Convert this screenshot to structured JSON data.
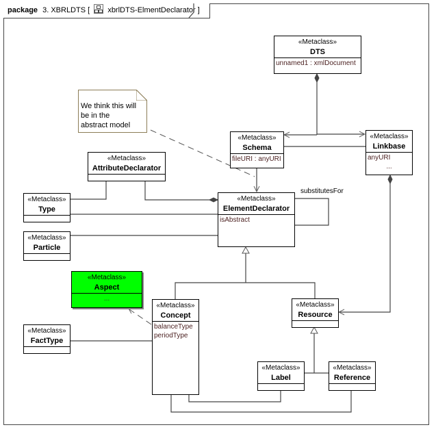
{
  "package": {
    "keyword": "package",
    "name": "3. XBRLDTS",
    "diagram_icon": "class-diagram-icon",
    "diagram_name": "xbrlDTS-ElmentDeclarator",
    "bracket_open": "[",
    "bracket_close": "]"
  },
  "note": {
    "text_lines": [
      "We think this will",
      "be in the",
      "abstract model"
    ]
  },
  "classes": {
    "dts": {
      "stereotype": "«Metaclass»",
      "name": "DTS",
      "attributes": [
        "unnamed1 : xmlDocument"
      ]
    },
    "schema": {
      "stereotype": "«Metaclass»",
      "name": "Schema",
      "attributes": [
        "fileURI : anyURI"
      ]
    },
    "linkbase": {
      "stereotype": "«Metaclass»",
      "name": "Linkbase",
      "attributes": [
        "anyURI",
        "..."
      ]
    },
    "attribute_declarator": {
      "stereotype": "«Metaclass»",
      "name": "AttributeDeclarator",
      "attributes": []
    },
    "type": {
      "stereotype": "«Metaclass»",
      "name": "Type",
      "attributes": []
    },
    "particle": {
      "stereotype": "«Metaclass»",
      "name": "Particle",
      "attributes": []
    },
    "element_declarator": {
      "stereotype": "«Metaclass»",
      "name": "ElementDeclarator",
      "attributes": [
        "isAbstract"
      ]
    },
    "aspect": {
      "stereotype": "«Metaclass»",
      "name": "Aspect",
      "attributes": [
        "..."
      ],
      "fill_color": "#00ff00"
    },
    "concept": {
      "stereotype": "«Metaclass»",
      "name": "Concept",
      "attributes": [
        "balanceType",
        "periodType"
      ]
    },
    "fact_type": {
      "stereotype": "«Metaclass»",
      "name": "FactType",
      "attributes": []
    },
    "resource": {
      "stereotype": "«Metaclass»",
      "name": "Resource",
      "attributes": []
    },
    "label": {
      "stereotype": "«Metaclass»",
      "name": "Label",
      "attributes": []
    },
    "reference": {
      "stereotype": "«Metaclass»",
      "name": "Reference",
      "attributes": []
    }
  },
  "relationships": [
    {
      "type": "composition-navigable",
      "from": "DTS",
      "to": "Schema"
    },
    {
      "type": "composition-navigable",
      "from": "DTS",
      "to": "Linkbase"
    },
    {
      "type": "association",
      "from": "Schema",
      "to": "Linkbase"
    },
    {
      "type": "composition-navigable",
      "from": "Schema",
      "to": "ElementDeclarator"
    },
    {
      "type": "composition",
      "from": "ElementDeclarator",
      "to": "AttributeDeclarator"
    },
    {
      "type": "association",
      "from": "AttributeDeclarator",
      "to": "Type"
    },
    {
      "type": "association",
      "from": "Type",
      "to": "ElementDeclarator"
    },
    {
      "type": "association",
      "from": "Particle",
      "to": "ElementDeclarator"
    },
    {
      "type": "self-association",
      "from": "ElementDeclarator",
      "to": "ElementDeclarator",
      "label": "substitutesFor"
    },
    {
      "type": "generalization",
      "from": "Concept",
      "to": "ElementDeclarator"
    },
    {
      "type": "generalization",
      "from": "Resource",
      "to": "ElementDeclarator"
    },
    {
      "type": "composition-navigable",
      "from": "Linkbase",
      "to": "Resource"
    },
    {
      "type": "generalization",
      "from": "Label",
      "to": "Resource"
    },
    {
      "type": "generalization",
      "from": "Reference",
      "to": "Resource"
    },
    {
      "type": "dependency",
      "from": "Concept",
      "to": "Aspect"
    },
    {
      "type": "association",
      "from": "FactType",
      "to": "Concept"
    },
    {
      "type": "association",
      "from": "Concept",
      "to": "Label"
    },
    {
      "type": "association",
      "from": "Concept",
      "to": "Reference"
    },
    {
      "type": "note-anchor",
      "from": "Note",
      "to": "ElementDeclarator"
    }
  ],
  "labels": {
    "substitutes_for": "substitutesFor"
  },
  "colors": {
    "line": "#444444",
    "note_border": "#8b7c56",
    "attribute_text": "#4a1f1f",
    "highlight": "#00ff00"
  }
}
